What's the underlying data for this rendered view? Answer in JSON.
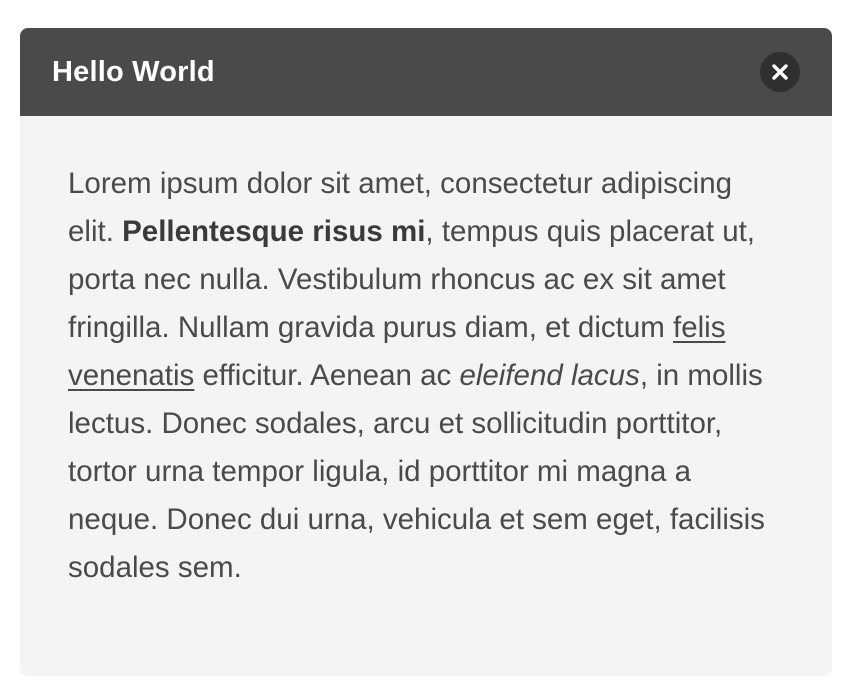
{
  "modal": {
    "title": "Hello World",
    "close_icon": "close-x-icon",
    "body": {
      "text_1": "Lorem ipsum dolor sit amet, consectetur adipiscing elit. ",
      "bold": "Pellentesque risus mi",
      "text_2": ", tempus quis placerat ut, porta nec nulla. Vestibulum rhoncus ac ex sit amet fringilla. Nullam gravida purus diam, et dictum ",
      "link": "felis venenatis",
      "text_3": " efficitur. Aenean ac ",
      "italic": "eleifend lacus",
      "text_4": ", in mollis lectus. Donec sodales, arcu et sollicitudin porttitor, tortor urna tempor ligula, id porttitor mi magna a neque. Donec dui urna, vehicula et sem eget, facilisis sodales sem."
    }
  },
  "colors": {
    "header_bg": "#4a4a4a",
    "body_bg": "#f4f4f4",
    "close_bg": "#2f2f2f",
    "text": "#4a4a4a"
  }
}
